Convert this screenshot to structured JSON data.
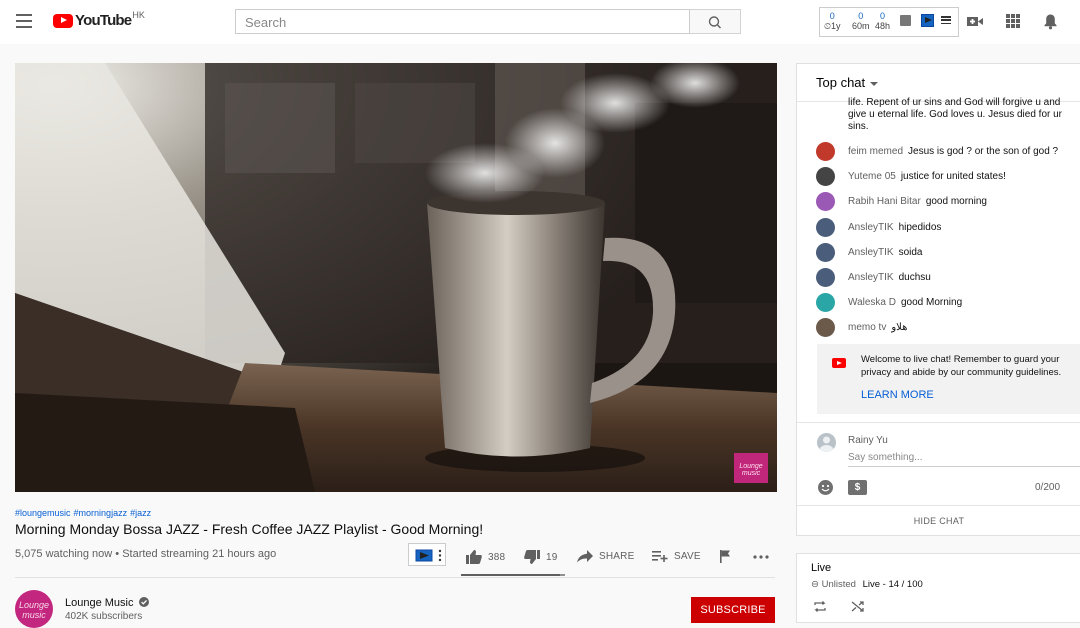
{
  "header": {
    "logo_text": "YouTube",
    "region": "HK",
    "search_placeholder": "Search",
    "stats": [
      {
        "value": "0",
        "label": "1y"
      },
      {
        "value": "0",
        "label": "60m"
      },
      {
        "value": "0",
        "label": "48h"
      }
    ]
  },
  "video": {
    "channel_watermark": "Lounge music",
    "hashtags": [
      "#loungemusic",
      "#morningjazz",
      "#jazz"
    ],
    "title": "Morning Monday Bossa JAZZ - Fresh Coffee JAZZ Playlist - Good Morning!",
    "meta": "5,075 watching now • Started streaming 21 hours ago",
    "likes": "388",
    "dislikes": "19",
    "like_ratio": 0.953,
    "share_label": "SHARE",
    "save_label": "SAVE"
  },
  "channel": {
    "avatar_text": "Lounge music",
    "name": "Lounge Music",
    "subscribers": "402K subscribers",
    "subscribe_label": "SUBSCRIBE"
  },
  "chat": {
    "header": "Top chat",
    "truncated_message": "life. Repent of ur sins and God will forgive u and give u eternal life. God loves u. Jesus died for ur sins.",
    "messages": [
      {
        "author": "feim memed",
        "text": "Jesus is god ? or the son of god ?",
        "color": "#c0392b"
      },
      {
        "author": "Yuteme 05",
        "text": "justice for united states!",
        "color": "#444444"
      },
      {
        "author": "Rabih Hani Bitar",
        "text": "good morning",
        "color": "#9b59b6"
      },
      {
        "author": "AnsleyTIK",
        "text": "hipedidos",
        "color": "#4a5d7a"
      },
      {
        "author": "AnsleyTIK",
        "text": "soida",
        "color": "#4a5d7a"
      },
      {
        "author": "AnsleyTIK",
        "text": "duchsu",
        "color": "#4a5d7a"
      },
      {
        "author": "Waleska D",
        "text": "good Morning",
        "color": "#2aa6a6"
      },
      {
        "author": "memo tv",
        "text": "هلاو",
        "color": "#6b5a4a"
      }
    ],
    "welcome": "Welcome to live chat! Remember to guard your privacy and abide by our community guidelines.",
    "learn_more": "LEARN MORE",
    "user_name": "Rainy Yu",
    "input_placeholder": "Say something...",
    "char_count": "0/200",
    "hide_chat": "HIDE CHAT"
  },
  "playlist": {
    "title": "Live",
    "visibility": "Unlisted",
    "position": "Live - 14 / 100"
  }
}
